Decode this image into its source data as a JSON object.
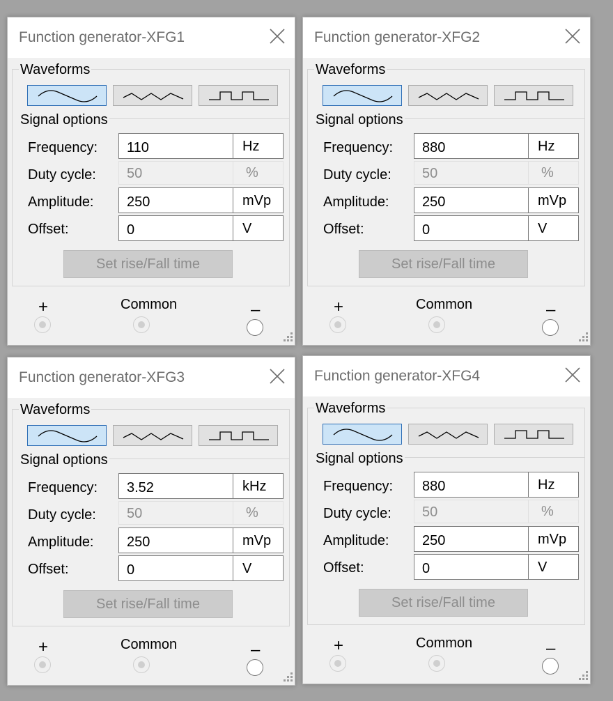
{
  "windows": [
    {
      "title": "Function generator-XFG1",
      "waveforms_label": "Waveforms",
      "selected_waveform": "sine",
      "signal_options_label": "Signal options",
      "frequency": {
        "label": "Frequency:",
        "value": "110",
        "unit": "Hz"
      },
      "duty_cycle": {
        "label": "Duty cycle:",
        "value": "50",
        "unit": "%"
      },
      "amplitude": {
        "label": "Amplitude:",
        "value": "250",
        "unit": "mVp"
      },
      "offset": {
        "label": "Offset:",
        "value": "0",
        "unit": "V"
      },
      "rise_button": "Set rise/Fall time",
      "terminals": {
        "plus": "+",
        "common": "Common",
        "minus": "–"
      }
    },
    {
      "title": "Function generator-XFG2",
      "waveforms_label": "Waveforms",
      "selected_waveform": "sine",
      "signal_options_label": "Signal options",
      "frequency": {
        "label": "Frequency:",
        "value": "880",
        "unit": "Hz"
      },
      "duty_cycle": {
        "label": "Duty cycle:",
        "value": "50",
        "unit": "%"
      },
      "amplitude": {
        "label": "Amplitude:",
        "value": "250",
        "unit": "mVp"
      },
      "offset": {
        "label": "Offset:",
        "value": "0",
        "unit": "V"
      },
      "rise_button": "Set rise/Fall time",
      "terminals": {
        "plus": "+",
        "common": "Common",
        "minus": "–"
      }
    },
    {
      "title": "Function generator-XFG3",
      "waveforms_label": "Waveforms",
      "selected_waveform": "sine",
      "signal_options_label": "Signal options",
      "frequency": {
        "label": "Frequency:",
        "value": "3.52",
        "unit": "kHz"
      },
      "duty_cycle": {
        "label": "Duty cycle:",
        "value": "50",
        "unit": "%"
      },
      "amplitude": {
        "label": "Amplitude:",
        "value": "250",
        "unit": "mVp"
      },
      "offset": {
        "label": "Offset:",
        "value": "0",
        "unit": "V"
      },
      "rise_button": "Set rise/Fall time",
      "terminals": {
        "plus": "+",
        "common": "Common",
        "minus": "–"
      }
    },
    {
      "title": "Function generator-XFG4",
      "waveforms_label": "Waveforms",
      "selected_waveform": "sine",
      "signal_options_label": "Signal options",
      "frequency": {
        "label": "Frequency:",
        "value": "880",
        "unit": "Hz"
      },
      "duty_cycle": {
        "label": "Duty cycle:",
        "value": "50",
        "unit": "%"
      },
      "amplitude": {
        "label": "Amplitude:",
        "value": "250",
        "unit": "mVp"
      },
      "offset": {
        "label": "Offset:",
        "value": "0",
        "unit": "V"
      },
      "rise_button": "Set rise/Fall time",
      "terminals": {
        "plus": "+",
        "common": "Common",
        "minus": "–"
      }
    }
  ],
  "icons": {
    "close": "close-icon",
    "waveform_buttons": [
      "sine-wave-icon",
      "triangle-wave-icon",
      "square-wave-icon"
    ],
    "resize_grip": "resize-grip-icon"
  },
  "colors": {
    "desktop": "#a2a2a2",
    "selected_button_fill": "#cce4f7",
    "selected_button_border": "#2f6fb6",
    "disabled_text": "#8d8d8d"
  }
}
